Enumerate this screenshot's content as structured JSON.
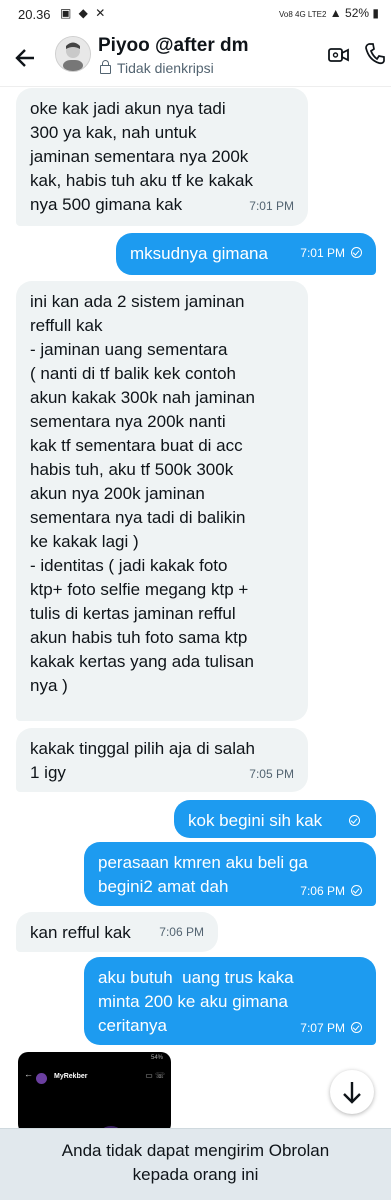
{
  "status_bar": {
    "time": "20.36",
    "network": "Vo8 4G LTE2",
    "battery": "52%"
  },
  "header": {
    "title": "Piyoo @after dm",
    "subtitle": "Tidak dienkripsi"
  },
  "messages": [
    {
      "direction": "in",
      "text": "oke kak jadi akun nya tadi\n300 ya kak, nah untuk\njaminan sementara nya 200k\nkak, habis tuh aku tf ke kakak\nnya 500 gimana kak",
      "time": "7:01 PM"
    },
    {
      "direction": "out",
      "text": "mksudnya gimana",
      "time": "7:01 PM"
    },
    {
      "direction": "in",
      "text": "ini kan ada 2 sistem jaminan\nreffull kak\n- jaminan uang sementara\n( nanti di tf balik kek contoh\nakun kakak 300k nah jaminan\nsementara nya 200k nanti\nkak tf sementara buat di acc\nhabis tuh, aku tf 500k 300k\nakun nya 200k jaminan\nsementara nya tadi di balikin\nke kakak lagi )\n- identitas ( jadi kakak foto\nktp+ foto selfie megang ktp +\ntulis di kertas jaminan refful\nakun habis tuh foto sama ktp\nkakak kertas yang ada tulisan\nnya )",
      "time": ""
    },
    {
      "direction": "in",
      "text": "kakak tinggal pilih aja di salah\n1 igy",
      "time": "7:05 PM"
    },
    {
      "direction": "out",
      "text": "kok begini sih kak",
      "time": ""
    },
    {
      "direction": "out",
      "text": "perasaan kmren aku beli ga\nbegini2 amat dah",
      "time": "7:06 PM"
    },
    {
      "direction": "in",
      "text": "kan refful kak",
      "time": "7:06 PM"
    },
    {
      "direction": "out",
      "text": "aku butuh  uang trus kaka\nminta 200 ke aku gimana\nceritanya",
      "time": "7:07 PM"
    }
  ],
  "attachment": {
    "app_name": "MyRekber",
    "battery": "54%"
  },
  "footer": {
    "notice": "Anda tidak dapat mengirim Obrolan kepada orang ini"
  }
}
